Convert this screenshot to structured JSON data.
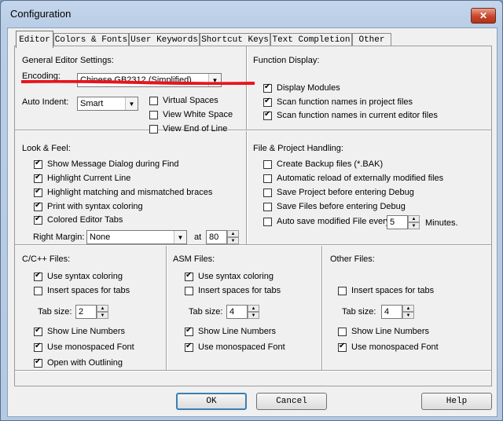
{
  "window": {
    "title": "Configuration",
    "close_glyph": "✕"
  },
  "tabs": [
    "Editor",
    "Colors & Fonts",
    "User Keywords",
    "Shortcut Keys",
    "Text Completion",
    "Other"
  ],
  "general": {
    "title": "General Editor Settings:",
    "encoding_label": "Encoding:",
    "encoding_value": "Chinese GB2312 (Simplified)",
    "auto_indent_label": "Auto Indent:",
    "auto_indent_value": "Smart",
    "virtual_spaces": "Virtual Spaces",
    "view_white_space": "View White Space",
    "view_end_of_line": "View End of Line"
  },
  "function_display": {
    "title": "Function Display:",
    "display_modules": "Display Modules",
    "scan_project": "Scan function names in project files",
    "scan_editor": "Scan function names in current editor files"
  },
  "look_feel": {
    "title": "Look & Feel:",
    "show_message": "Show Message Dialog during Find",
    "highlight_line": "Highlight Current Line",
    "highlight_braces": "Highlight matching and mismatched braces",
    "print_syntax": "Print with syntax coloring",
    "colored_tabs": "Colored Editor Tabs",
    "right_margin_label": "Right Margin:",
    "right_margin_value": "None",
    "at_label": "at",
    "at_value": "80"
  },
  "file_handling": {
    "title": "File & Project Handling:",
    "create_backup": "Create Backup files (*.BAK)",
    "auto_reload": "Automatic reload of externally modified files",
    "save_project": "Save Project before entering Debug",
    "save_files": "Save Files before entering Debug",
    "auto_save": "Auto save modified File every",
    "auto_save_value": "5",
    "minutes": "Minutes."
  },
  "cpp_files": {
    "title": "C/C++ Files:",
    "use_syntax": "Use syntax coloring",
    "insert_spaces": "Insert spaces for tabs",
    "tab_size_label": "Tab size:",
    "tab_size_value": "2",
    "show_line_numbers": "Show Line Numbers",
    "monospaced": "Use monospaced Font",
    "outlining": "Open with Outlining"
  },
  "asm_files": {
    "title": "ASM Files:",
    "use_syntax": "Use syntax coloring",
    "insert_spaces": "Insert spaces for tabs",
    "tab_size_label": "Tab size:",
    "tab_size_value": "4",
    "show_line_numbers": "Show Line Numbers",
    "monospaced": "Use monospaced Font"
  },
  "other_files": {
    "title": "Other Files:",
    "insert_spaces": "Insert spaces for tabs",
    "tab_size_label": "Tab size:",
    "tab_size_value": "4",
    "show_line_numbers": "Show Line Numbers",
    "monospaced": "Use monospaced Font"
  },
  "buttons": {
    "ok": "OK",
    "cancel": "Cancel",
    "help": "Help"
  },
  "colors": {
    "annotation_red": "#e8141b",
    "close_red": "#c8452c"
  }
}
